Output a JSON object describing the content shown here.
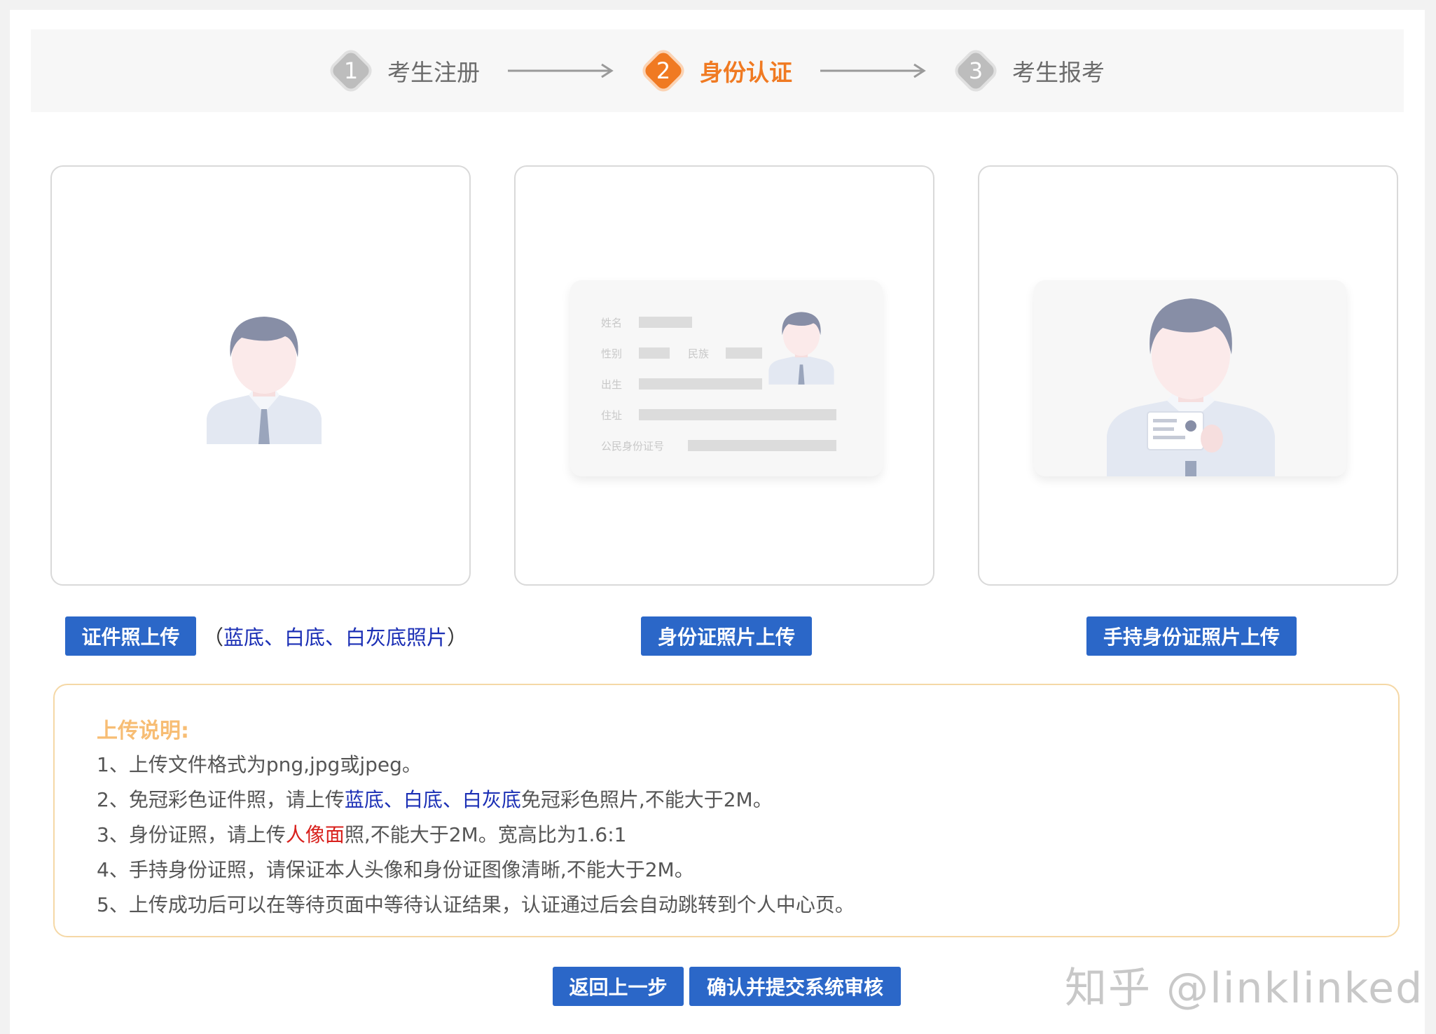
{
  "steps": [
    {
      "num": "1",
      "label": "考生注册",
      "state": "done"
    },
    {
      "num": "2",
      "label": "身份认证",
      "state": "active"
    },
    {
      "num": "3",
      "label": "考生报考",
      "state": "pending"
    }
  ],
  "colors": {
    "active_step": "#f07a22",
    "inactive_step": "#bdbdbd",
    "button": "#2b67c8",
    "notes_border": "#f5d8a6",
    "notes_title": "#f7bd74",
    "link_blue": "#1b2fb5",
    "warn_red": "#d8201c"
  },
  "cards": [
    {
      "icon": "portrait-placeholder-icon"
    },
    {
      "icon": "id-card-placeholder-icon",
      "card_fields": {
        "name": "姓名",
        "gender": "性别",
        "ethnicity": "民族",
        "birth": "出生",
        "address": "住址",
        "id_number": "公民身份证号"
      }
    },
    {
      "icon": "holding-id-placeholder-icon"
    }
  ],
  "buttons": {
    "id_photo": "证件照上传",
    "id_card": "身份证照片上传",
    "holding_id": "手持身份证照片上传",
    "back": "返回上一步",
    "submit": "确认并提交系统审核"
  },
  "hint": {
    "open": "（",
    "text": "蓝底、白底、白灰底照片",
    "close": "）"
  },
  "notes": {
    "title": "上传说明:",
    "line1": "1、上传文件格式为png,jpg或jpeg。",
    "line2_a": "2、免冠彩色证件照，请上传",
    "line2_b": "蓝底、白底、白灰底",
    "line2_c": "免冠彩色照片,不能大于2M。",
    "line3_a": "3、身份证照，请上传",
    "line3_b": "人像面",
    "line3_c": "照,不能大于2M。宽高比为1.6:1",
    "line4": "4、手持身份证照，请保证本人头像和身份证图像清晰,不能大于2M。",
    "line5": "5、上传成功后可以在等待页面中等待认证结果，认证通过后会自动跳转到个人中心页。"
  },
  "watermark": "知乎 @linklinked"
}
